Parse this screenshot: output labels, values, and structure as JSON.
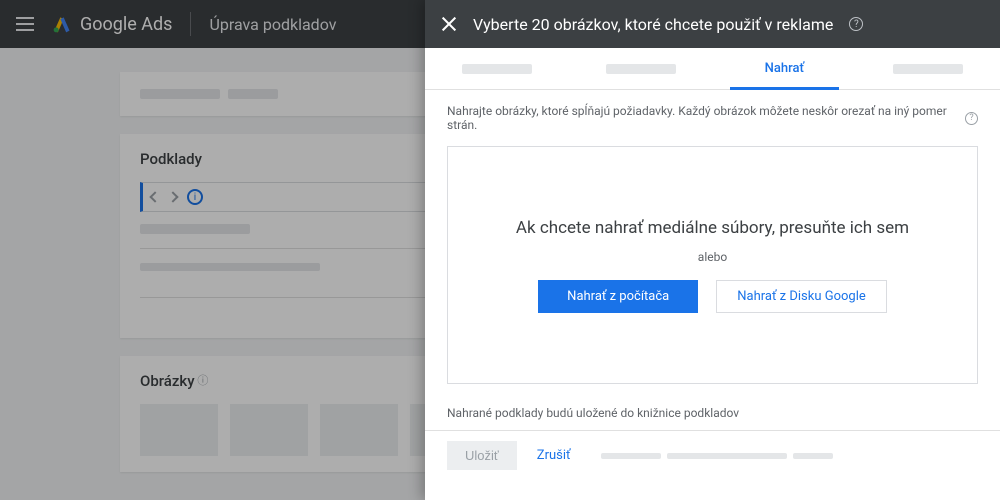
{
  "app": {
    "product": "Google Ads",
    "subtitle": "Úprava podkladov"
  },
  "bg": {
    "section_assets": "Podklady",
    "section_images": "Obrázky"
  },
  "modal": {
    "title": "Vyberte 20 obrázkov, ktoré chcete použiť v reklame",
    "tabs": {
      "active": "Nahrať"
    },
    "hint": "Nahrajte obrázky, ktoré spĺňajú požiadavky. Každý obrázok môžete neskôr orezať na iný pomer strán.",
    "dropzone": {
      "title": "Ak chcete nahrať mediálne súbory, presuňte ich sem",
      "or": "alebo",
      "btn_upload": "Nahrať z počítača",
      "btn_drive": "Nahrať z Disku Google"
    },
    "footer_note": "Nahrané podklady budú uložené do knižnice podkladov",
    "actions": {
      "save": "Uložiť",
      "cancel": "Zrušiť"
    }
  }
}
